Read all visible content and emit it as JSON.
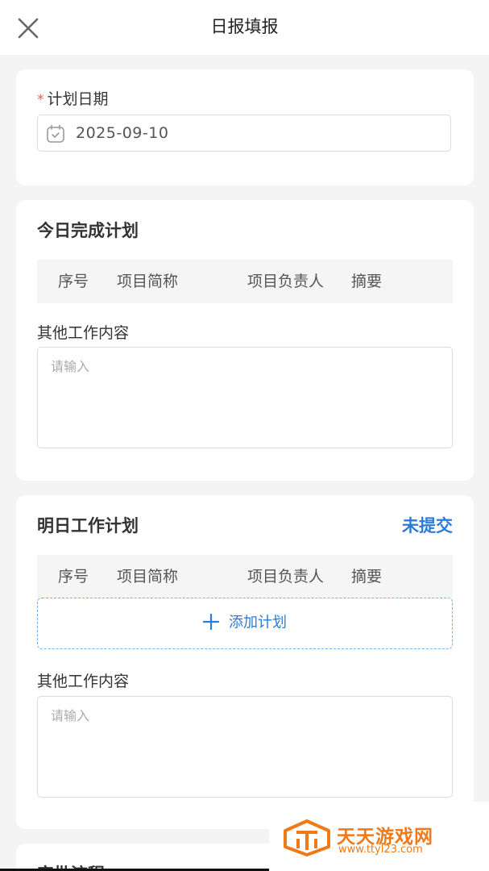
{
  "header": {
    "title": "日报填报",
    "close_icon": "close-icon"
  },
  "plan_date": {
    "required_mark": "*",
    "label": "计划日期",
    "value": "2025-09-10",
    "icon": "calendar-icon"
  },
  "today_plan": {
    "title": "今日完成计划",
    "columns": [
      "序号",
      "项目简称",
      "项目负责人",
      "摘要"
    ],
    "other_label": "其他工作内容",
    "other_placeholder": "请输入"
  },
  "tomorrow_plan": {
    "title": "明日工作计划",
    "status": "未提交",
    "columns": [
      "序号",
      "项目简称",
      "项目负责人",
      "摘要"
    ],
    "add_label": "添加计划",
    "other_label": "其他工作内容",
    "other_placeholder": "请输入"
  },
  "approval": {
    "title": "审批流程"
  },
  "watermark": {
    "name": "天天游戏网",
    "url": "www.ttyl23.com"
  },
  "colors": {
    "accent": "#2d7bd6",
    "required": "#e55b4d",
    "watermark": "#ef7a1a"
  }
}
